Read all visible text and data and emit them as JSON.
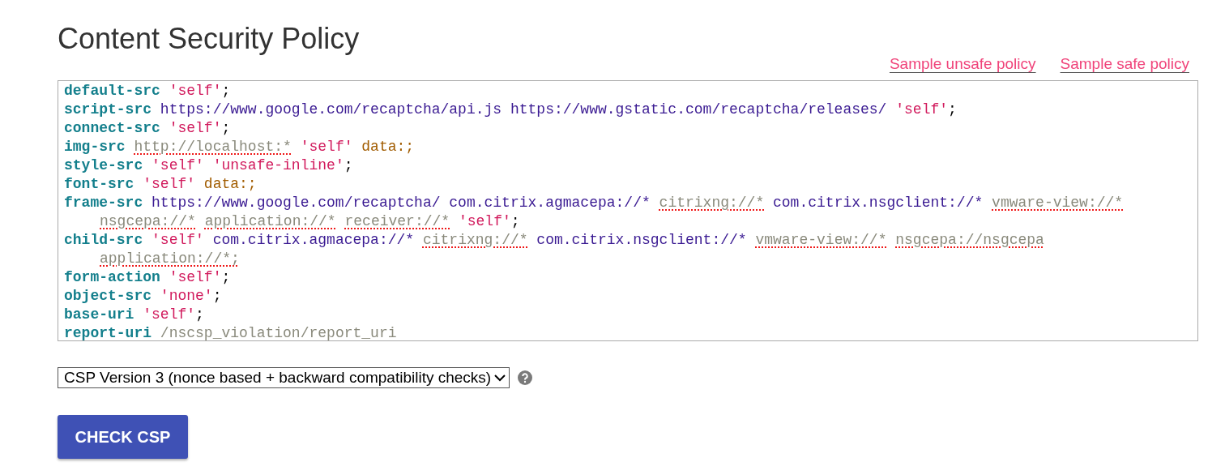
{
  "title": "Content Security Policy",
  "links": [
    {
      "label": "Sample unsafe policy"
    },
    {
      "label": "Sample safe policy"
    }
  ],
  "policy": [
    {
      "lines": [
        {
          "tokens": [
            {
              "kind": "directive",
              "text": "default-src"
            },
            {
              "kind": "keyword",
              "text": "'self'"
            },
            {
              "kind": "punct",
              "text": ";"
            }
          ]
        }
      ]
    },
    {
      "lines": [
        {
          "tokens": [
            {
              "kind": "directive",
              "text": "script-src"
            },
            {
              "kind": "url",
              "text": "https://www.google.com/recaptcha/api.js"
            },
            {
              "kind": "url",
              "text": "https://www.gstatic.com/recaptcha/releases/"
            },
            {
              "kind": "keyword",
              "text": "'self'"
            },
            {
              "kind": "punct",
              "text": ";"
            }
          ]
        }
      ]
    },
    {
      "lines": [
        {
          "tokens": [
            {
              "kind": "directive",
              "text": "connect-src"
            },
            {
              "kind": "keyword",
              "text": "'self'"
            },
            {
              "kind": "punct",
              "text": ";"
            }
          ]
        }
      ]
    },
    {
      "lines": [
        {
          "tokens": [
            {
              "kind": "directive",
              "text": "img-src"
            },
            {
              "kind": "warning",
              "text": "http://localhost:*"
            },
            {
              "kind": "keyword",
              "text": "'self'"
            },
            {
              "kind": "data",
              "text": "data:;"
            }
          ]
        }
      ]
    },
    {
      "lines": [
        {
          "tokens": [
            {
              "kind": "directive",
              "text": "style-src"
            },
            {
              "kind": "keyword",
              "text": "'self'"
            },
            {
              "kind": "keyword",
              "text": "'unsafe-inline'"
            },
            {
              "kind": "punct",
              "text": ";"
            }
          ]
        }
      ]
    },
    {
      "lines": [
        {
          "tokens": [
            {
              "kind": "directive",
              "text": "font-src"
            },
            {
              "kind": "keyword",
              "text": "'self'"
            },
            {
              "kind": "data",
              "text": "data:;"
            }
          ]
        }
      ]
    },
    {
      "lines": [
        {
          "tokens": [
            {
              "kind": "directive",
              "text": "frame-src"
            },
            {
              "kind": "url",
              "text": "https://www.google.com/recaptcha/"
            },
            {
              "kind": "url",
              "text": "com.citrix.agmacepa://*"
            },
            {
              "kind": "warning",
              "text": "citrixng://*"
            },
            {
              "kind": "url",
              "text": "com.citrix.nsgclient://*"
            },
            {
              "kind": "warning",
              "text": "vmware-view://*"
            }
          ]
        },
        {
          "tokens": [
            {
              "kind": "warning",
              "text": "nsgcepa://*"
            },
            {
              "kind": "warning",
              "text": "application://*"
            },
            {
              "kind": "warning",
              "text": "receiver://*"
            },
            {
              "kind": "keyword",
              "text": "'self'"
            },
            {
              "kind": "punct",
              "text": ";"
            }
          ]
        }
      ]
    },
    {
      "lines": [
        {
          "tokens": [
            {
              "kind": "directive",
              "text": "child-src"
            },
            {
              "kind": "keyword",
              "text": "'self'"
            },
            {
              "kind": "url",
              "text": "com.citrix.agmacepa://*"
            },
            {
              "kind": "warning",
              "text": "citrixng://*"
            },
            {
              "kind": "url",
              "text": "com.citrix.nsgclient://*"
            },
            {
              "kind": "warning",
              "text": "vmware-view://*"
            },
            {
              "kind": "warning",
              "text": "nsgcepa://nsgcepa"
            }
          ]
        },
        {
          "tokens": [
            {
              "kind": "warning",
              "text": "application://*;"
            }
          ]
        }
      ]
    },
    {
      "lines": [
        {
          "tokens": [
            {
              "kind": "directive",
              "text": "form-action"
            },
            {
              "kind": "keyword",
              "text": "'self'"
            },
            {
              "kind": "punct",
              "text": ";"
            }
          ]
        }
      ]
    },
    {
      "lines": [
        {
          "tokens": [
            {
              "kind": "directive",
              "text": "object-src"
            },
            {
              "kind": "keyword",
              "text": "'none'"
            },
            {
              "kind": "punct",
              "text": ";"
            }
          ]
        }
      ]
    },
    {
      "lines": [
        {
          "tokens": [
            {
              "kind": "directive",
              "text": "base-uri"
            },
            {
              "kind": "keyword",
              "text": "'self'"
            },
            {
              "kind": "punct",
              "text": ";"
            }
          ]
        }
      ]
    },
    {
      "lines": [
        {
          "tokens": [
            {
              "kind": "directive",
              "text": "report-uri"
            },
            {
              "kind": "path",
              "text": "/nscsp_violation/report_uri"
            }
          ]
        }
      ]
    }
  ],
  "version_select": {
    "value": "CSP Version 3 (nonce based + backward compatibility checks)"
  },
  "check_button": {
    "label": "CHECK CSP"
  }
}
